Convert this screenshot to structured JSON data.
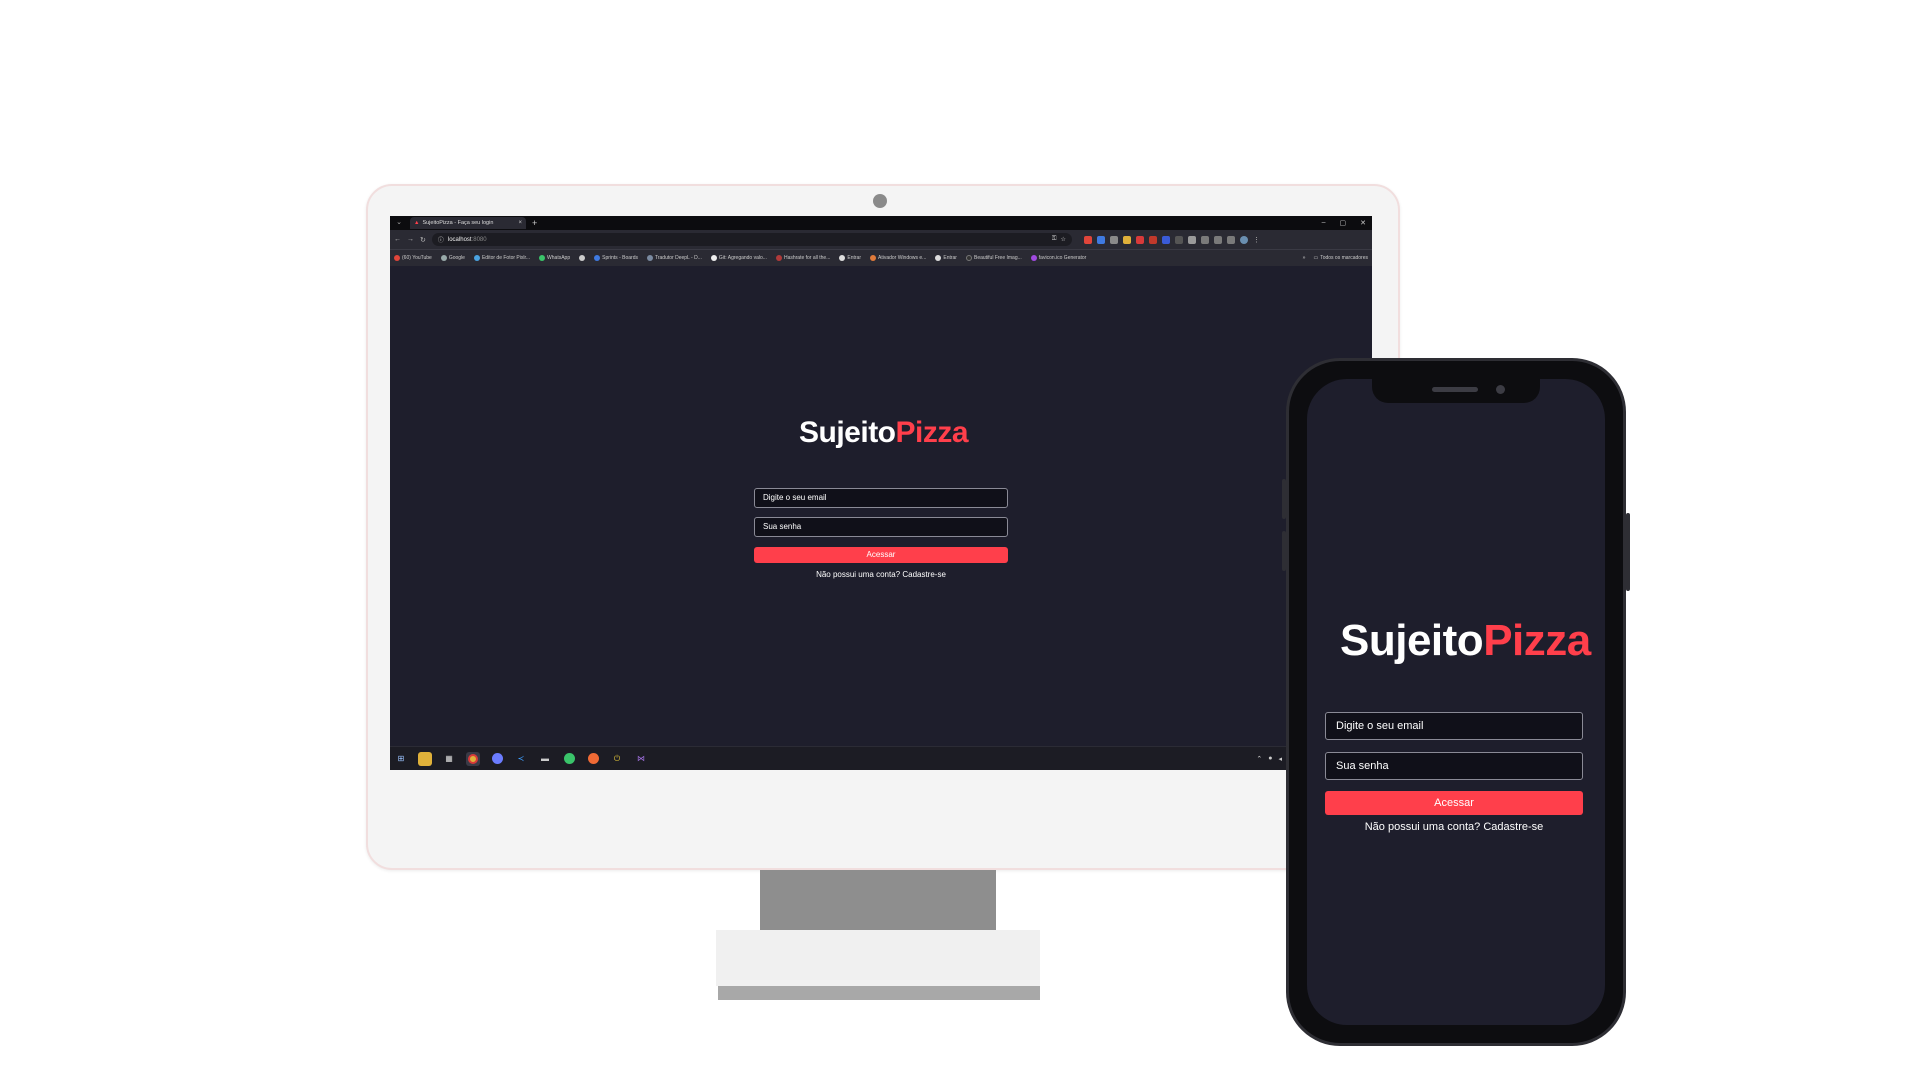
{
  "browser": {
    "tab_title": "SujeitoPizza - Faça seu login",
    "tab_close": "×",
    "new_tab": "+",
    "window_controls": [
      "–",
      "▢",
      "✕"
    ],
    "url_host": "localhost",
    "url_port": ":8080",
    "bookmarks": [
      "(60) YouTube",
      "Google",
      "Editor de Fotor Pixlr...",
      "WhatsApp",
      "Sprints - Boards",
      "Tradutor DeepL - D...",
      "Git: Agregando valo...",
      "Hashrate for all the...",
      "Entrar",
      "Ativador Windows e...",
      "Entrar",
      "Beautiful Free Imag...",
      "favicon.ico Generator"
    ],
    "bookmarks_more": "»",
    "bookmarks_folder": "Todos os marcadores"
  },
  "app": {
    "logo_white": "Sujeito",
    "logo_red": "Pizza",
    "email_placeholder": "Digite o seu email",
    "password_placeholder": "Sua senha",
    "submit_label": "Acessar",
    "signup_link": "Não possui uma conta? Cadastre-se"
  },
  "colors": {
    "accent": "#ff3f4b",
    "background": "#1e1e2c",
    "input_background": "#101019"
  },
  "taskbar_icons": [
    "windows-start-icon",
    "file-explorer-icon",
    "calendar-icon",
    "chrome-icon",
    "discord-icon",
    "vscode-icon",
    "terminal-icon",
    "whatsapp-icon",
    "postman-icon",
    "power-icon",
    "visual-studio-icon"
  ]
}
